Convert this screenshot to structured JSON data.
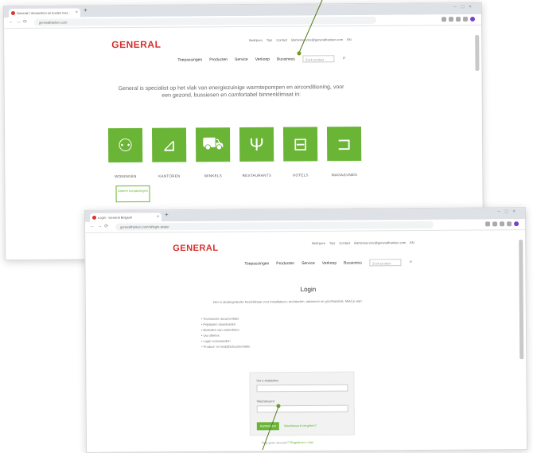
{
  "window1": {
    "tab_title": "General | Verwarmen en koelen met...",
    "url": "generalfranken.com",
    "logo": "GENERAL",
    "top_links": [
      "Bedrijven",
      "Tips",
      "Contact",
      "klantenservice@generalfranken.com",
      "EN"
    ],
    "nav": [
      "Toepassingen",
      "Producten",
      "Service",
      "Verkoop",
      "Bussiness"
    ],
    "search_placeholder": "Zoek product",
    "intro": "General is specialist op het vlak van energiezuinige warmtepompen en airconditioning, voor een gezond, bussiesen en comfortabel binnenklimaat in:",
    "categories": [
      "WONINGEN",
      "KANTOREN",
      "WINKELS",
      "RESTAURANTS",
      "HOTELS",
      "MAGAZIJNEN"
    ],
    "category_icons": [
      "people-icon",
      "desk-icon",
      "cart-icon",
      "cutlery-icon",
      "bed-icon",
      "forklift-icon"
    ],
    "more_button": "Andere toepassingen"
  },
  "window2": {
    "tab_title": "Login - General Belgium",
    "url": "generalfranken.com/nl/login-dealer",
    "logo": "GENERAL",
    "top_links": [
      "Bedrijven",
      "Tips",
      "Contact",
      "klantenservice@generalfranken.com",
      "EN"
    ],
    "nav": [
      "Toepassingen",
      "Producten",
      "Service",
      "Verkoop",
      "Bussiness"
    ],
    "search_placeholder": "Zoek product",
    "login_title": "Login",
    "login_description": "Hier is dealergedeelte beschikbaar voor installateurs, architecten, adviseurs en groothandels. Meld je aan:",
    "benefits": [
      "Technische documentatie",
      "Prijslijsten downloaden",
      "Bestellen van onderdelen",
      "Uw offertes",
      "Login voorwaarden",
      "Product- en bedrijfsdocumentatie"
    ],
    "username_label": "Uw e-mailadres",
    "password_label": "Wachtwoord",
    "login_button": "Aanmelden",
    "forgot_link": "Wachtwoord vergeten?",
    "footer_text": "Nog geen account?",
    "footer_link": "Registreer u hier"
  },
  "colors": {
    "brand_red": "#d42e2a",
    "accent_green": "#6ab536",
    "pointer": "#4f7a14"
  }
}
